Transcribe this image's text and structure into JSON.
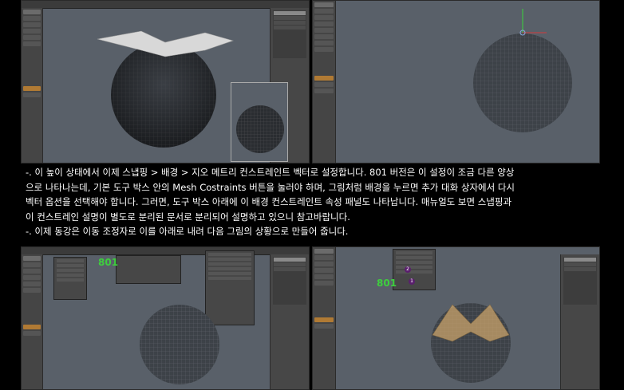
{
  "paragraphs": [
    "-. 이 높이 상태에서 이제 스냅핑 > 배경 > 지오 메트리 컨스트레인트 벡터로 설정합니다. 801 버전은 이 설정이 조금 다른 양상",
    "으로 나타나는데, 기본 도구 박스 안의 Mesh Costraints 버튼을 눌러야 하며, 그림처럼 배경을 누르면 추가 대화 상자에서 다시",
    "벡터 옵션을 선택해야 합니다. 그러면, 도구 박스 아래에 이 배경 컨스트레인트 속성 패널도 나타납니다. 매뉴얼도 보면 스냅핑과",
    "이 컨스트레인 설명이 별도로 분리된 문서로 분리되어 설명하고 있으니 참고바랍니다.",
    "-. 이제 동강은 이동 조정자로 이를 아래로 내려 다음 그림의 상황으로 만들어 줍니다."
  ],
  "screenshots": {
    "bottom_left_version_label": "801",
    "bottom_right_version_label": "801",
    "step_badges": [
      "2",
      "1"
    ]
  },
  "colors": {
    "viewport_bg": "#596069",
    "panel_bg": "#474747",
    "version_label": "#3ecf3e",
    "patch_fill": "#c9a36a",
    "step_badge": "#5a1f6d"
  },
  "icons": [
    "sphere-wireframe-icon",
    "axis-gizmo-icon",
    "step-badge-icon"
  ]
}
